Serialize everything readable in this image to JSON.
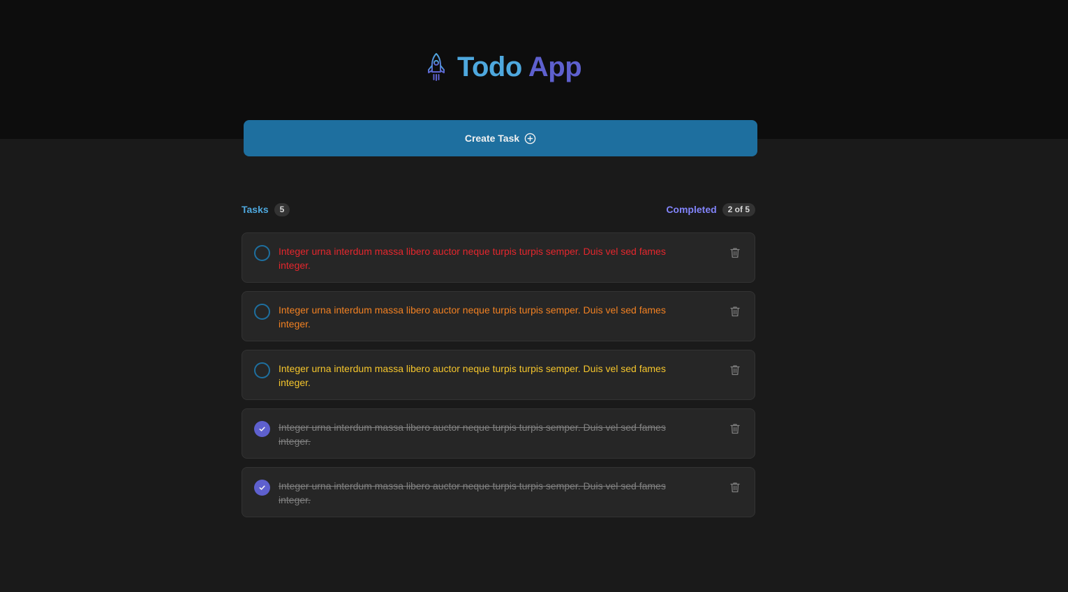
{
  "app": {
    "title_part1": "Todo",
    "title_part2": "App",
    "logo_icon": "rocket-icon",
    "colors": {
      "brand_blue": "#4ea8de",
      "brand_purple": "#5e60ce",
      "button_bg": "#1e6f9f",
      "completed_label": "#8284fa"
    }
  },
  "toolbar": {
    "create_label": "Create Task",
    "create_icon": "plus-circle-icon"
  },
  "summary": {
    "tasks_label": "Tasks",
    "tasks_count": "5",
    "completed_label": "Completed",
    "completed_count": "2 of 5"
  },
  "tasks": [
    {
      "text": "Integer urna interdum massa libero auctor neque turpis turpis semper. Duis vel sed fames integer.",
      "completed": false,
      "color": "#e5262d"
    },
    {
      "text": "Integer urna interdum massa libero auctor neque turpis turpis semper. Duis vel sed fames integer.",
      "completed": false,
      "color": "#f28122"
    },
    {
      "text": "Integer urna interdum massa libero auctor neque turpis turpis semper. Duis vel sed fames integer.",
      "completed": false,
      "color": "#f6c62c"
    },
    {
      "text": "Integer urna interdum massa libero auctor neque turpis turpis semper. Duis vel sed fames integer.",
      "completed": true,
      "color": "#808080"
    },
    {
      "text": "Integer urna interdum massa libero auctor neque turpis turpis semper. Duis vel sed fames integer.",
      "completed": true,
      "color": "#808080"
    }
  ]
}
